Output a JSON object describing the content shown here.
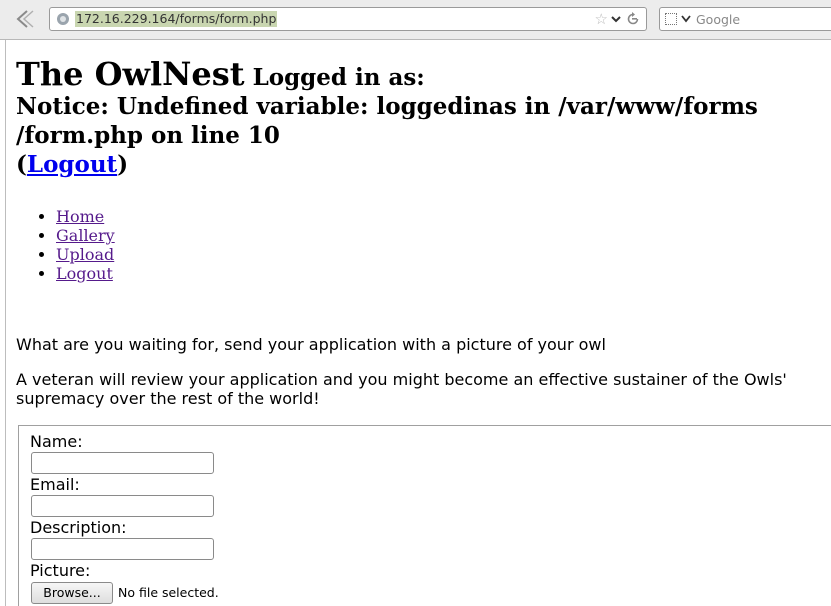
{
  "browser": {
    "url": "172.16.229.164/forms/form.php",
    "search_placeholder": "Google"
  },
  "header": {
    "site_name": "The OwlNest",
    "logged_in_text": "Logged in as:",
    "notice_line1": "Notice: Undefined variable: loggedinas in /var/www/forms",
    "notice_line2": "/form.php on line 10",
    "paren_open": "(",
    "logout_label": "Logout",
    "paren_close": ")"
  },
  "nav": {
    "items": [
      {
        "label": "Home"
      },
      {
        "label": "Gallery"
      },
      {
        "label": "Upload"
      },
      {
        "label": "Logout"
      }
    ]
  },
  "main": {
    "intro": "What are you waiting for, send your application with a picture of your owl",
    "review": "A veteran will review your application and you might become an effective sustainer of the Owls' supremacy over the rest of the world!"
  },
  "form": {
    "name_label": "Name:",
    "name_value": "",
    "email_label": "Email:",
    "email_value": "",
    "description_label": "Description:",
    "description_value": "",
    "picture_label": "Picture:",
    "browse_label": "Browse...",
    "file_status": "No file selected."
  }
}
